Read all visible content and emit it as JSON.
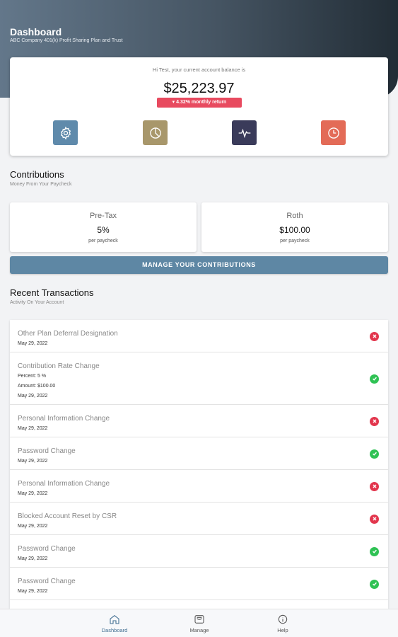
{
  "header": {
    "title": "Dashboard",
    "subtitle": "ABC Company 401(k) Profit Sharing Plan and Trust"
  },
  "balance": {
    "greeting": "Hi Test, your current account balance is",
    "amount": "$25,223.97",
    "return_badge": "▾ 4.32% monthly return"
  },
  "quick_actions": [
    {
      "icon": "gear-icon",
      "color": "#5f8aab"
    },
    {
      "icon": "pie-chart-icon",
      "color": "#a8976b"
    },
    {
      "icon": "pulse-icon",
      "color": "#3a3b5a"
    },
    {
      "icon": "clock-icon",
      "color": "#e36b57"
    }
  ],
  "contributions": {
    "title": "Contributions",
    "subtitle": "Money From Your Paycheck",
    "pretax": {
      "label": "Pre-Tax",
      "value": "5%",
      "sub": "per paycheck"
    },
    "roth": {
      "label": "Roth",
      "value": "$100.00",
      "sub": "per paycheck"
    },
    "manage_label": "MANAGE YOUR CONTRIBUTIONS"
  },
  "transactions": {
    "title": "Recent Transactions",
    "subtitle": "Activity On Your Account",
    "items": [
      {
        "title": "Other Plan Deferral Designation",
        "details": [
          "May 29, 2022"
        ],
        "status": "failed"
      },
      {
        "title": "Contribution Rate Change",
        "details": [
          "Percent: 5 %",
          "Amount: $100.00",
          "May 29, 2022"
        ],
        "status": "success"
      },
      {
        "title": "Personal Information Change",
        "details": [
          "May 29, 2022"
        ],
        "status": "failed"
      },
      {
        "title": "Password Change",
        "details": [
          "May 29, 2022"
        ],
        "status": "success"
      },
      {
        "title": "Personal Information Change",
        "details": [
          "May 29, 2022"
        ],
        "status": "failed"
      },
      {
        "title": "Blocked Account Reset by CSR",
        "details": [
          "May 29, 2022"
        ],
        "status": "failed"
      },
      {
        "title": "Password Change",
        "details": [
          "May 29, 2022"
        ],
        "status": "success"
      },
      {
        "title": "Password Change",
        "details": [
          "May 29, 2022"
        ],
        "status": "success"
      }
    ]
  },
  "tabbar": {
    "dashboard": "Dashboard",
    "manage": "Manage",
    "help": "Help",
    "active": "dashboard"
  },
  "colors": {
    "accent": "#5e87a4",
    "failed": "#e2364d",
    "success": "#2fc254",
    "return_badge": "#e84a5f"
  }
}
